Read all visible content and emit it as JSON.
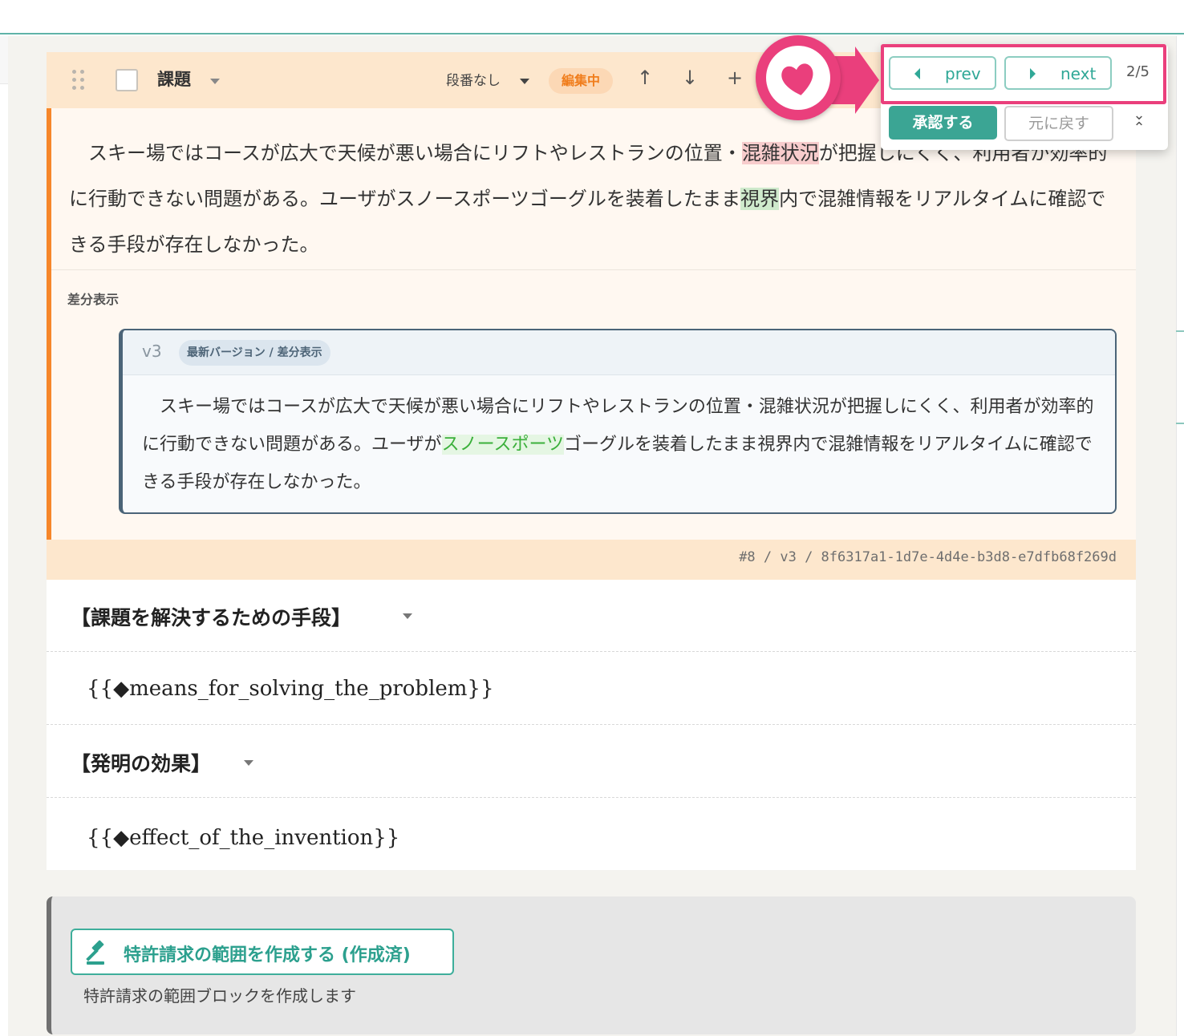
{
  "block": {
    "title": "課題",
    "numbering": "段番なし",
    "status": "編集中",
    "main_text": {
      "before_del": "スキー場ではコースが広大で天候が悪い場合にリフトやレストランの位置・",
      "deleted": "混雑状況",
      "after_del": "が把握しにくく、利用者が効率的に行動できない問題がある。ユーザがスノースポーツゴーグルを装着したまま",
      "inserted": "視界",
      "after_ins": "内で混雑情報をリアルタイムに確認できる手段が存在しなかった。"
    },
    "diff_label": "差分表示",
    "diff": {
      "version": "v3",
      "badge": "最新バージョン / 差分表示",
      "before_ins": "スキー場ではコースが広大で天候が悪い場合にリフトやレストランの位置・混雑状況が把握しにくく、利用者が効率的に行動できない問題がある。ユーザが",
      "inserted": "スノースポーツ",
      "after_ins": "ゴーグルを装着したまま視界内で混雑情報をリアルタイムに確認できる手段が存在しなかった。"
    },
    "meta": "#8 / v3 / 8f6317a1-1d7e-4d4e-b3d8-e7dfb68f269d"
  },
  "sections": [
    {
      "title": "【課題を解決するための手段】",
      "body": "{{◆means_for_solving_the_problem}}"
    },
    {
      "title": "【発明の効果】",
      "body": "{{◆effect_of_the_invention}}"
    }
  ],
  "create": {
    "button_label": "特許請求の範囲を作成する (作成済)",
    "description": "特許請求の範囲ブロックを作成します",
    "icon": "gavel-icon"
  },
  "popup": {
    "prev_label": "prev",
    "next_label": "next",
    "counter": "2/5",
    "approve_label": "承認する",
    "revert_label": "元に戻す",
    "collapse_icon": "collapse-icon"
  },
  "colors": {
    "accent": "#3ba594",
    "highlight": "#ea3f7c",
    "editing": "#f07d1c",
    "header_bg": "#fde7cd",
    "deleted_bg": "#f7cccc",
    "inserted_bg": "#cfeacc"
  }
}
